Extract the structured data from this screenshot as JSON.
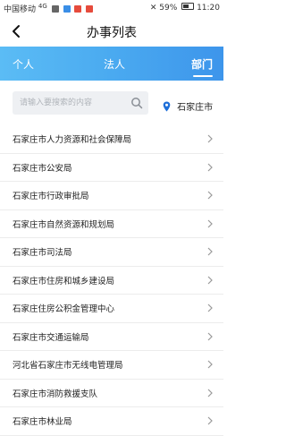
{
  "status_bar": {
    "carrier": "中国移动",
    "signal": "4G",
    "battery": "59%",
    "time": "11:20"
  },
  "header": {
    "title": "办事列表"
  },
  "tabs": [
    {
      "label": "个人"
    },
    {
      "label": "法人"
    },
    {
      "label": "部门"
    }
  ],
  "search": {
    "placeholder": "请输入要搜索的内容",
    "value": ""
  },
  "location": {
    "city": "石家庄市"
  },
  "departments": [
    {
      "name": "石家庄市人力资源和社会保障局"
    },
    {
      "name": "石家庄市公安局"
    },
    {
      "name": "石家庄市行政审批局"
    },
    {
      "name": "石家庄市自然资源和规划局"
    },
    {
      "name": "石家庄市司法局"
    },
    {
      "name": "石家庄市住房和城乡建设局"
    },
    {
      "name": "石家庄住房公积金管理中心"
    },
    {
      "name": "石家庄市交通运输局"
    },
    {
      "name": "河北省石家庄市无线电管理局"
    },
    {
      "name": "石家庄市消防救援支队"
    },
    {
      "name": "石家庄市林业局"
    }
  ],
  "colors": {
    "accent": "#4aaaf0",
    "location_pin": "#1e6fd9"
  }
}
